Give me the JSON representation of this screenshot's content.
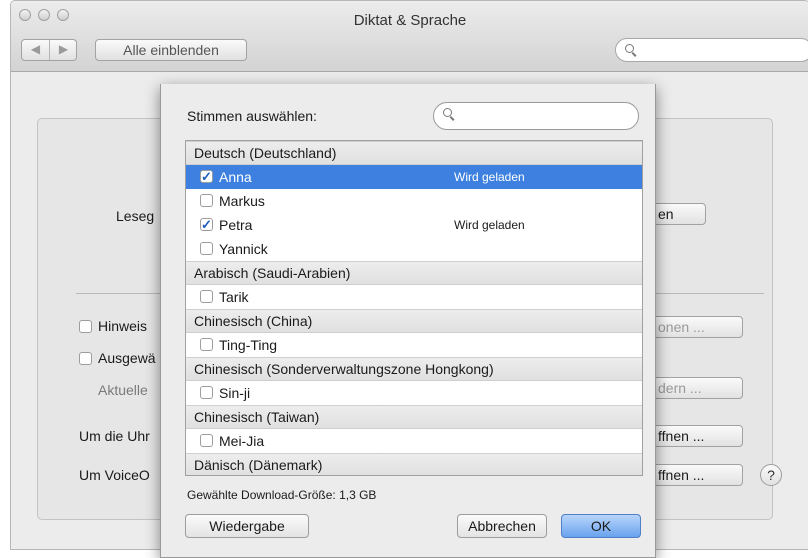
{
  "window": {
    "title": "Diktat & Sprache"
  },
  "toolbar": {
    "back": "◀",
    "forward": "▶",
    "show_all": "Alle einblenden",
    "search_placeholder": ""
  },
  "background": {
    "lese_label": "Leseg",
    "hinweis_label": "Hinweis",
    "ausgew_label": "Ausgewä",
    "aktuelle_label": "Aktuelle",
    "uhr_label": "Um die Uhr",
    "voiceover_label": "Um VoiceO",
    "btn_en": "en",
    "btn_optionen": "onen ...",
    "btn_andern": "dern ...",
    "btn_offnen1": "ffnen ...",
    "btn_offnen2": "ffnen ...",
    "help": "?"
  },
  "sheet": {
    "label": "Stimmen auswählen:",
    "search_placeholder": "",
    "groups": [
      {
        "name": "Deutsch (Deutschland)",
        "voices": [
          {
            "name": "Anna",
            "checked": true,
            "status": "Wird geladen",
            "selected": true
          },
          {
            "name": "Markus",
            "checked": false,
            "status": "",
            "selected": false
          },
          {
            "name": "Petra",
            "checked": true,
            "status": "Wird geladen",
            "selected": false
          },
          {
            "name": "Yannick",
            "checked": false,
            "status": "",
            "selected": false
          }
        ]
      },
      {
        "name": "Arabisch (Saudi-Arabien)",
        "voices": [
          {
            "name": "Tarik",
            "checked": false,
            "status": "",
            "selected": false
          }
        ]
      },
      {
        "name": "Chinesisch (China)",
        "voices": [
          {
            "name": "Ting-Ting",
            "checked": false,
            "status": "",
            "selected": false
          }
        ]
      },
      {
        "name": "Chinesisch (Sonderverwaltungszone Hongkong)",
        "voices": [
          {
            "name": "Sin-ji",
            "checked": false,
            "status": "",
            "selected": false
          }
        ]
      },
      {
        "name": "Chinesisch (Taiwan)",
        "voices": [
          {
            "name": "Mei-Jia",
            "checked": false,
            "status": "",
            "selected": false
          }
        ]
      },
      {
        "name": "Dänisch (Dänemark)",
        "voices": []
      }
    ],
    "download_size": "Gewählte Download-Größe: 1,3 GB",
    "buttons": {
      "play": "Wiedergabe",
      "cancel": "Abbrechen",
      "ok": "OK"
    }
  },
  "colors": {
    "selection": "#3d80df",
    "default_button": "#6aa2ee"
  }
}
